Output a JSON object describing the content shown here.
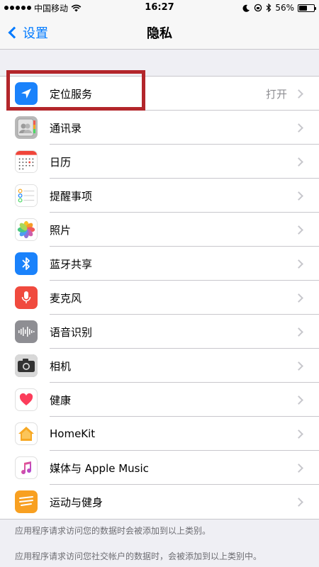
{
  "status": {
    "carrier": "中国移动",
    "time": "16:27",
    "battery": "56%",
    "battery_level": 0.56
  },
  "nav": {
    "back_label": "设置",
    "title": "隐私"
  },
  "items": [
    {
      "label": "定位服务",
      "value": "打开",
      "icon": "location-arrow-icon",
      "color": "#1a82fb"
    },
    {
      "label": "通讯录",
      "value": "",
      "icon": "contacts-icon",
      "color": "#b8b8b8"
    },
    {
      "label": "日历",
      "value": "",
      "icon": "calendar-icon",
      "color": "#ffffff"
    },
    {
      "label": "提醒事项",
      "value": "",
      "icon": "reminders-icon",
      "color": "#ffffff"
    },
    {
      "label": "照片",
      "value": "",
      "icon": "photos-icon",
      "color": "#ffffff"
    },
    {
      "label": "蓝牙共享",
      "value": "",
      "icon": "bluetooth-icon",
      "color": "#1a82fb"
    },
    {
      "label": "麦克风",
      "value": "",
      "icon": "microphone-icon",
      "color": "#f04a3e"
    },
    {
      "label": "语音识别",
      "value": "",
      "icon": "speech-waveform-icon",
      "color": "#8e8e93"
    },
    {
      "label": "相机",
      "value": "",
      "icon": "camera-icon",
      "color": "#8e8e93"
    },
    {
      "label": "健康",
      "value": "",
      "icon": "health-heart-icon",
      "color": "#ffffff"
    },
    {
      "label": "HomeKit",
      "value": "",
      "icon": "homekit-house-icon",
      "color": "#ffffff"
    },
    {
      "label": "媒体与 Apple Music",
      "value": "",
      "icon": "music-note-icon",
      "color": "#ffffff"
    },
    {
      "label": "运动与健身",
      "value": "",
      "icon": "motion-fitness-icon",
      "color": "#f8a021"
    }
  ],
  "footnotes": [
    "应用程序请求访问您的数据时会被添加到以上类别。",
    "应用程序请求访问您社交帐户的数据时，会被添加到以上类别中。"
  ]
}
